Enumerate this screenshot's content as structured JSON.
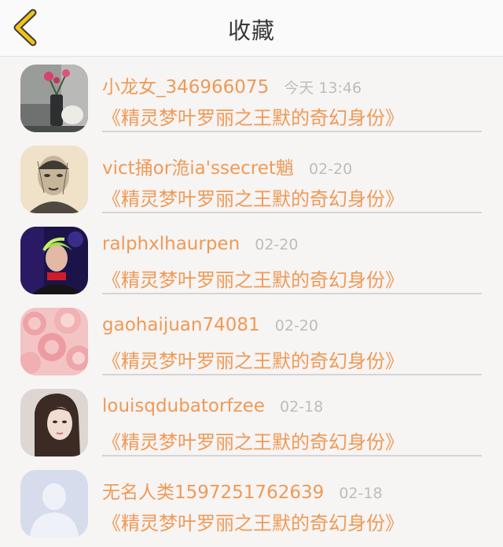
{
  "header": {
    "title": "收藏",
    "back_icon": "chevron-left-icon",
    "accent_color": "#f2c21a"
  },
  "favorites": [
    {
      "username": "小龙女_346966075",
      "time": "今天 13:46",
      "book": "《精灵梦叶罗丽之王默的奇幻身份》",
      "avatar": "flower-vase-avatar"
    },
    {
      "username": "vict捅or洈ia'ssecret魈",
      "time": "02-20",
      "book": "《精灵梦叶罗丽之王默的奇幻身份》",
      "avatar": "sketch-portrait-avatar"
    },
    {
      "username": "ralphxlhaurpen",
      "time": "02-20",
      "book": "《精灵梦叶罗丽之王默的奇幻身份》",
      "avatar": "green-hair-avatar"
    },
    {
      "username": "gaohaijuan74081",
      "time": "02-20",
      "book": "《精灵梦叶罗丽之王默的奇幻身份》",
      "avatar": "pink-roses-avatar"
    },
    {
      "username": "louisqdubatorfzee",
      "time": "02-18",
      "book": "《精灵梦叶罗丽之王默的奇幻身份》",
      "avatar": "girl-portrait-avatar"
    },
    {
      "username": "无名人类1597251762639",
      "time": "02-18",
      "book": "《精灵梦叶罗丽之王默的奇幻身份》",
      "avatar": "default-person-avatar"
    }
  ],
  "colors": {
    "username": "#ef9a55",
    "time": "#bdbdbd",
    "background": "#f7f4f4"
  }
}
